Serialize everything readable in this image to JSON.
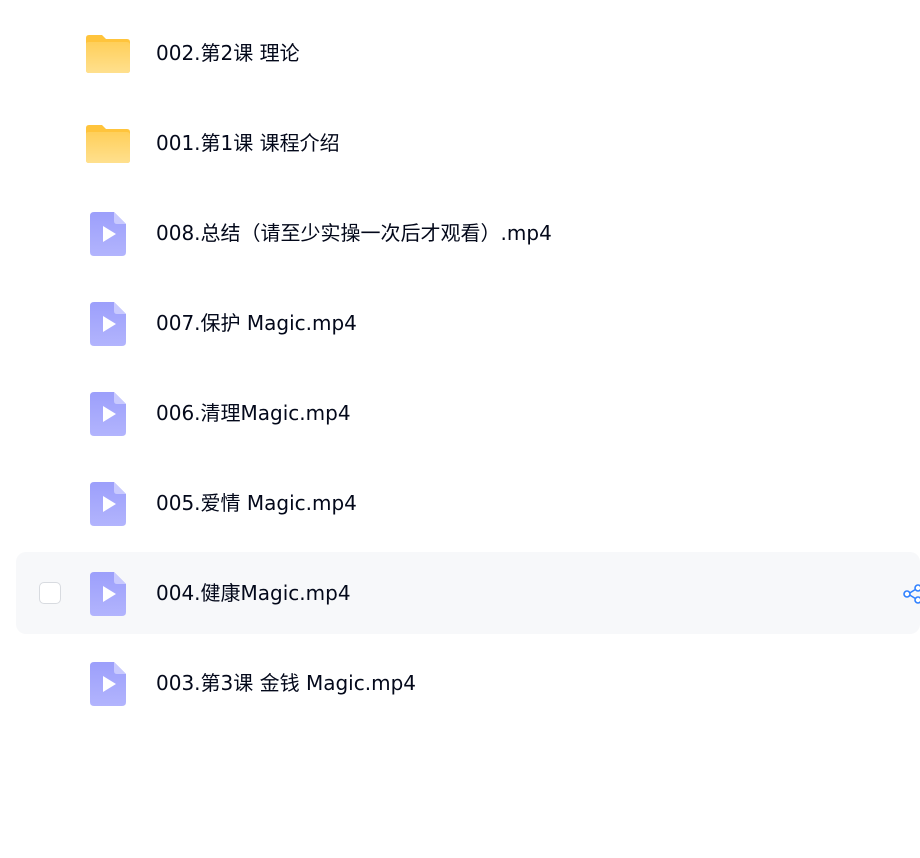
{
  "files": [
    {
      "name": "002.第2课 理论",
      "type": "folder"
    },
    {
      "name": "001.第1课 课程介绍",
      "type": "folder"
    },
    {
      "name": "008.总结（请至少实操一次后才观看）.mp4",
      "type": "video"
    },
    {
      "name": "007.保护 Magic.mp4",
      "type": "video"
    },
    {
      "name": "006.清理Magic.mp4",
      "type": "video"
    },
    {
      "name": "005.爱情 Magic.mp4",
      "type": "video"
    },
    {
      "name": "004.健康Magic.mp4",
      "type": "video",
      "hovered": true
    },
    {
      "name": "003.第3课 金钱 Magic.mp4",
      "type": "video"
    }
  ],
  "colors": {
    "folder": "#ffd76b",
    "video": "#a3a6fb",
    "share_icon": "#2f80ff",
    "hover_bg": "#f7f8fa"
  },
  "icons": {
    "folder": "folder-icon",
    "video": "video-file-icon",
    "share": "share-icon"
  }
}
